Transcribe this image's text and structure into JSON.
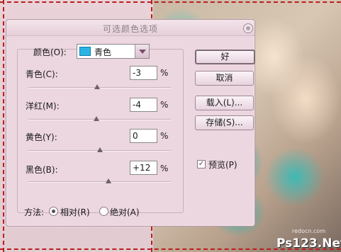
{
  "dialog": {
    "title": "可选颜色选项",
    "color_label": "颜色(O):",
    "color_value": "青色",
    "swatch_color": "#2ab4e6",
    "sliders": [
      {
        "label": "青色(C):",
        "value": "-3",
        "unit": "%",
        "level": -3
      },
      {
        "label": "洋红(M):",
        "value": "-4",
        "unit": "%",
        "level": -4
      },
      {
        "label": "黄色(Y):",
        "value": "0",
        "unit": "%",
        "level": 0
      },
      {
        "label": "黑色(B):",
        "value": "+12",
        "unit": "%",
        "level": 12
      }
    ],
    "buttons": {
      "ok": "好",
      "cancel": "取消",
      "load": "载入(L)...",
      "save": "存储(S)..."
    },
    "preview": {
      "label": "预览(P)",
      "checked": true,
      "check_mark": "✓"
    },
    "method": {
      "label": "方法:",
      "options": [
        {
          "label": "相对(R)",
          "selected": true
        },
        {
          "label": "绝对(A)",
          "selected": false
        }
      ]
    }
  },
  "watermark": {
    "text": "Ps123.Net",
    "sub_text": "redocn.com"
  },
  "colors": {
    "selection_border": "#b81f1f",
    "dialog_bg": "#ecd6df"
  }
}
